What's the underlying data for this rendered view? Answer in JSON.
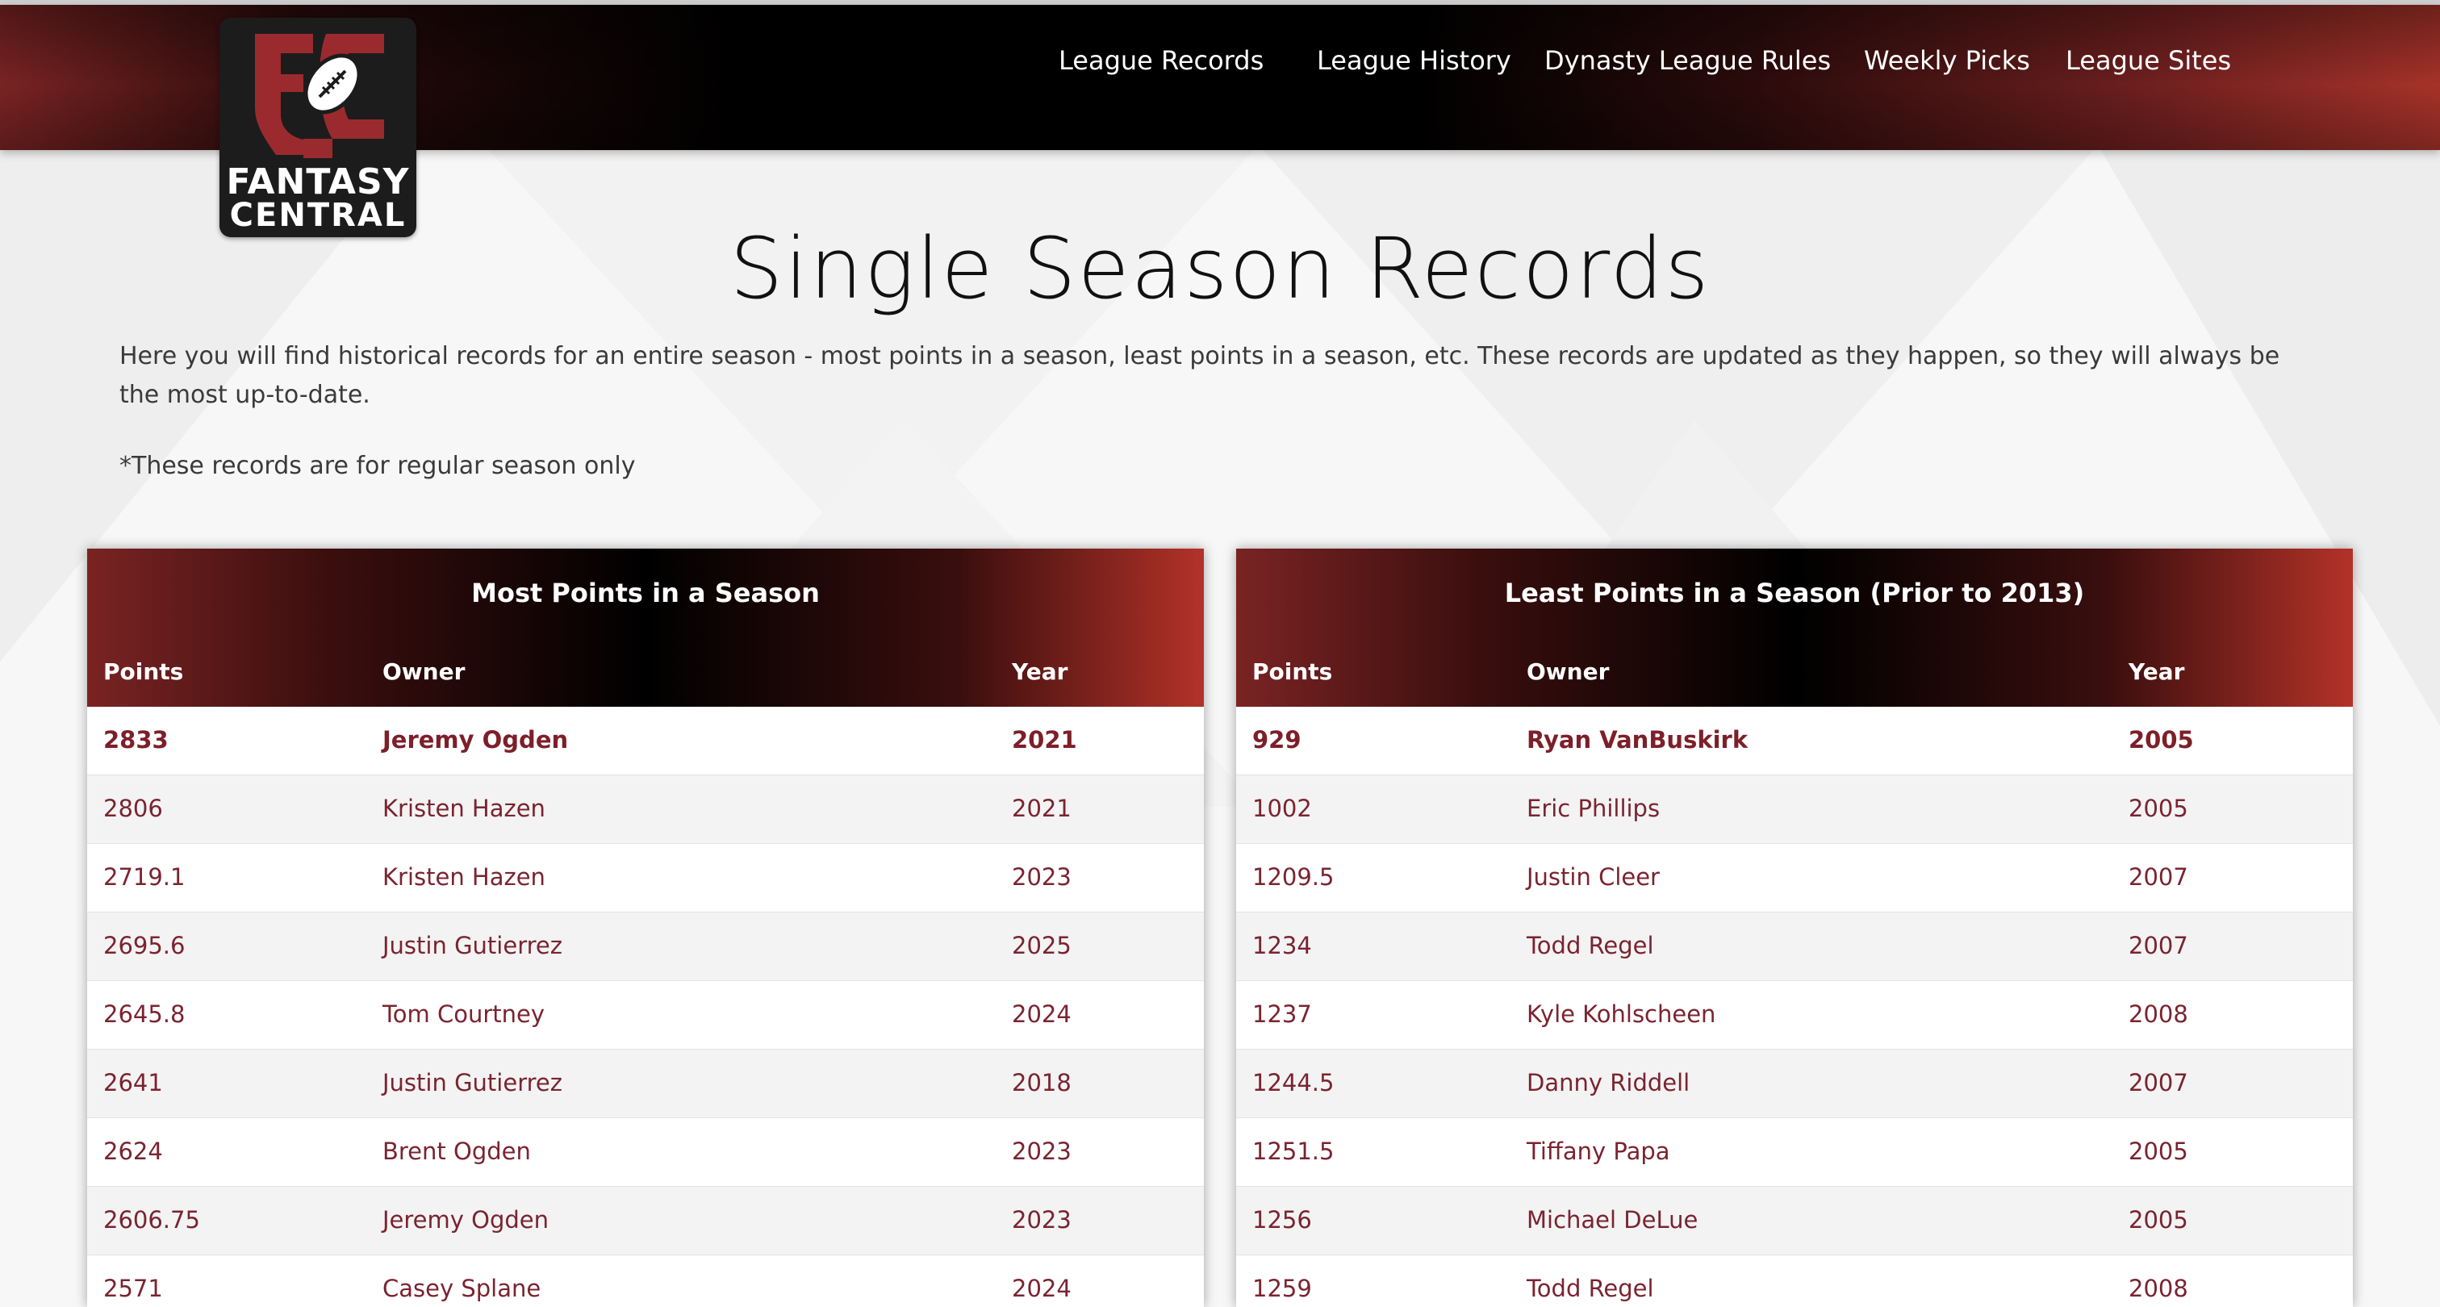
{
  "nav": {
    "items": [
      {
        "label": "League Records"
      },
      {
        "label": "League History"
      },
      {
        "label": "Dynasty League Rules"
      },
      {
        "label": "Weekly Picks"
      },
      {
        "label": "League Sites"
      }
    ]
  },
  "logo": {
    "line1": "FANTASY",
    "line2": "CENTRAL"
  },
  "page": {
    "title": "Single Season Records",
    "intro": "Here you will find historical records for an entire season - most points in a season, least points in a season, etc. These records are updated as they happen, so they will always be the most up-to-date.",
    "note": "*These records are for regular season only"
  },
  "colors": {
    "accent": "#7d1f29",
    "header_dark": "#000000",
    "header_red": "#a63229"
  },
  "tables": [
    {
      "title": "Most Points in a Season",
      "columns": [
        "Points",
        "Owner",
        "Year"
      ],
      "rows": [
        [
          "2833",
          "Jeremy Ogden",
          "2021"
        ],
        [
          "2806",
          "Kristen Hazen",
          "2021"
        ],
        [
          "2719.1",
          "Kristen Hazen",
          "2023"
        ],
        [
          "2695.6",
          "Justin Gutierrez",
          "2025"
        ],
        [
          "2645.8",
          "Tom Courtney",
          "2024"
        ],
        [
          "2641",
          "Justin Gutierrez",
          "2018"
        ],
        [
          "2624",
          "Brent Ogden",
          "2023"
        ],
        [
          "2606.75",
          "Jeremy Ogden",
          "2023"
        ],
        [
          "2571",
          "Casey Splane",
          "2024"
        ]
      ]
    },
    {
      "title": "Least Points in a Season (Prior to 2013)",
      "columns": [
        "Points",
        "Owner",
        "Year"
      ],
      "rows": [
        [
          "929",
          "Ryan VanBuskirk",
          "2005"
        ],
        [
          "1002",
          "Eric Phillips",
          "2005"
        ],
        [
          "1209.5",
          "Justin Cleer",
          "2007"
        ],
        [
          "1234",
          "Todd Regel",
          "2007"
        ],
        [
          "1237",
          "Kyle Kohlscheen",
          "2008"
        ],
        [
          "1244.5",
          "Danny Riddell",
          "2007"
        ],
        [
          "1251.5",
          "Tiffany Papa",
          "2005"
        ],
        [
          "1256",
          "Michael DeLue",
          "2005"
        ],
        [
          "1259",
          "Todd Regel",
          "2008"
        ]
      ]
    }
  ]
}
